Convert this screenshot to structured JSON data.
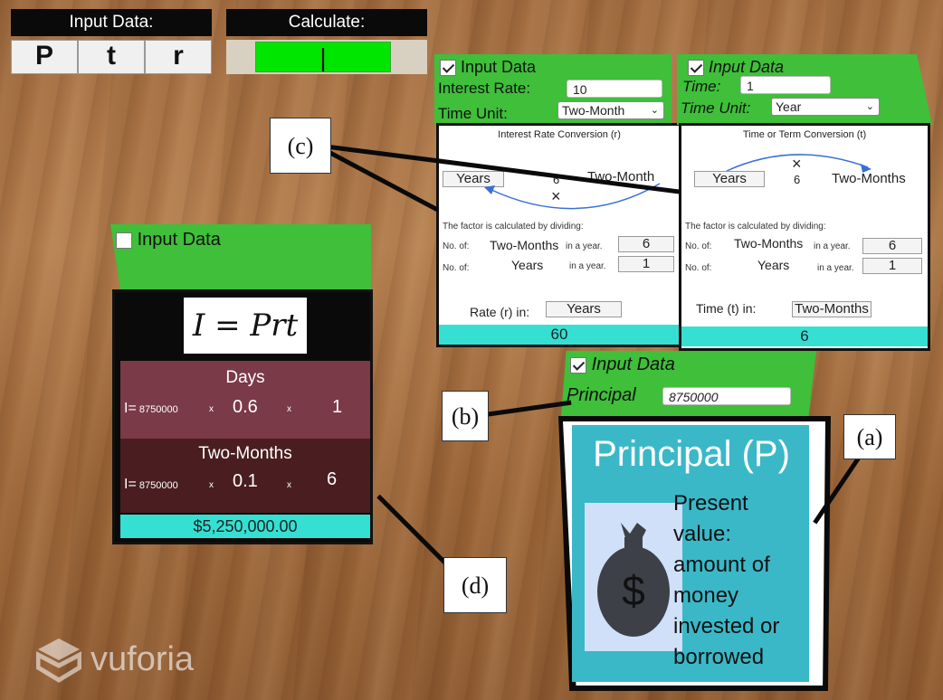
{
  "toolbar": {
    "input_header": "Input Data:",
    "calc_header": "Calculate:",
    "buttons": [
      "P",
      "t",
      "r"
    ],
    "calc_button": "|"
  },
  "rate_panel": {
    "title": "Input Data",
    "interest_rate_label": "Interest Rate:",
    "interest_rate_value": "10",
    "time_unit_label": "Time Unit:",
    "time_unit_value": "Two-Month",
    "conversion_title": "Interest Rate Conversion (r)",
    "from_unit": "Years",
    "mid_value": "6",
    "times": "×",
    "to_unit": "Two-Month",
    "factor_text": "The factor is calculated by dividing:",
    "no_of": "No. of:",
    "row1_unit": "Two-Months",
    "in_a_year": "in a year.",
    "row1_value": "6",
    "row2_unit": "Years",
    "row2_value": "1",
    "rate_in_label": "Rate (r) in:",
    "rate_in_value": "Years",
    "result": "60"
  },
  "time_panel": {
    "title": "Input Data",
    "time_label": "Time:",
    "time_value": "1",
    "time_unit_label": "Time Unit:",
    "time_unit_value": "Year",
    "conversion_title": "Time or Term Conversion (t)",
    "from_unit": "Years",
    "times": "×",
    "mid_value": "6",
    "to_unit": "Two-Months",
    "factor_text": "The factor is calculated by dividing:",
    "no_of": "No. of:",
    "row1_unit": "Two-Months",
    "in_a_year": "in a year.",
    "row1_value": "6",
    "row2_unit": "Years",
    "row2_value": "1",
    "time_in_label": "Time (t) in:",
    "time_in_value": "Two-Months",
    "result": "6"
  },
  "principal_panel": {
    "title": "Input Data",
    "principal_label": "Principal",
    "principal_value": "8750000",
    "card_title": "Principal (P)",
    "description": [
      "Present",
      "value:",
      "amount of",
      "money",
      "invested or",
      "borrowed"
    ],
    "bag_symbol": "$"
  },
  "formula_panel": {
    "title": "Input Data",
    "formula": "I = Prt",
    "days_label": "Days",
    "days_prefix": "I=",
    "days_p": "8750000",
    "x": "x",
    "days_r": "0.6",
    "days_t": "1",
    "two_label": "Two-Months",
    "two_prefix": "I=",
    "two_p": "8750000",
    "two_r": "0.1",
    "two_t": "6",
    "result": "$5,250,000.00"
  },
  "callouts": [
    "(a)",
    "(b)",
    "(c)",
    "(d)"
  ],
  "watermark": "vuforia",
  "colors": {
    "green": "#3fbf3a",
    "teal": "#35e0d2",
    "calc": "#00e600",
    "card": "#3ab8c8"
  }
}
